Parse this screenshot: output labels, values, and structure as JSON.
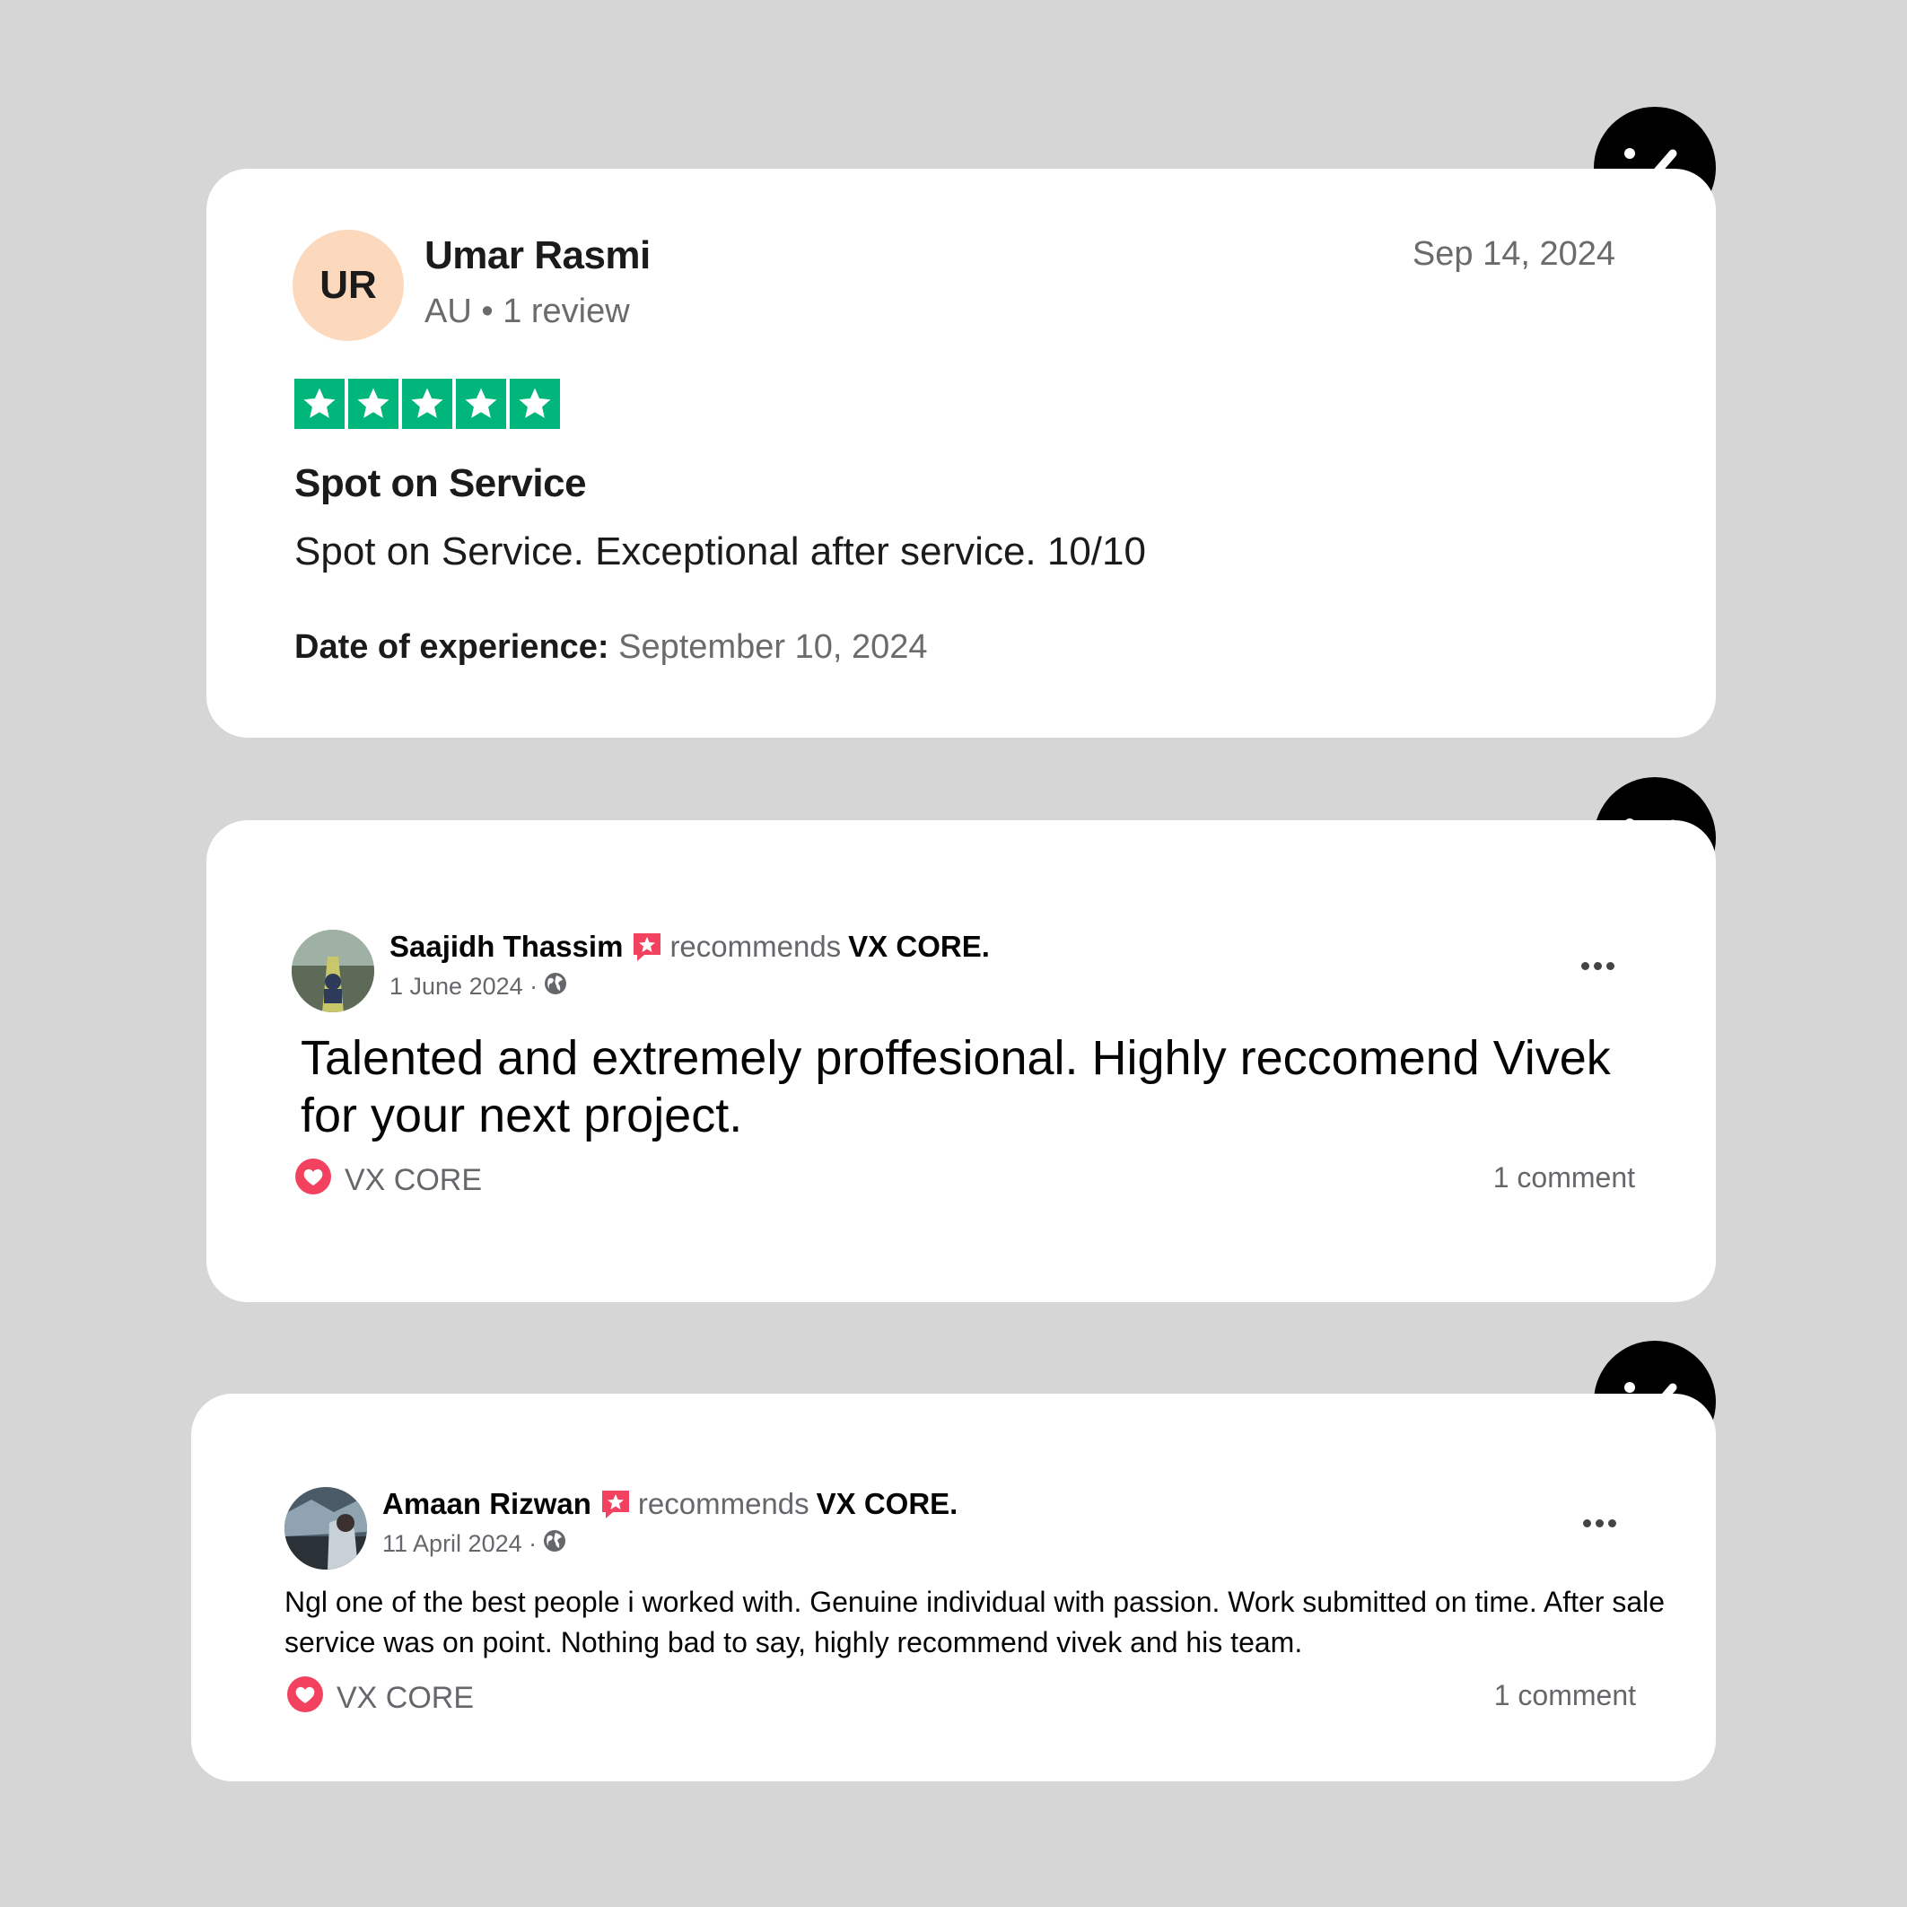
{
  "reviews": [
    {
      "source": "trustpilot",
      "avatar_initials": "UR",
      "reviewer_name": "Umar Rasmi",
      "reviewer_meta": "AU • 1 review",
      "date": "Sep 14, 2024",
      "rating": 5,
      "title": "Spot on Service",
      "body": "Spot on Service. Exceptional after service. 10/10",
      "experience_label": "Date of experience:",
      "experience_date": "September 10, 2024",
      "star_color": "#00b67a"
    },
    {
      "source": "facebook",
      "reviewer_name": "Saajidh Thassim",
      "recommends_text": "recommends",
      "page_name": "VX CORE.",
      "date": "1 June 2024 ·",
      "body": "Talented and extremely proffesional. Highly reccomend Vivek for your next project.",
      "reaction_name": "VX CORE",
      "comment_count": "1 comment"
    },
    {
      "source": "facebook",
      "reviewer_name": "Amaan Rizwan",
      "recommends_text": "recommends",
      "page_name": "VX CORE.",
      "date": "11 April 2024 ·",
      "body": "Ngl one of the best people i worked with. Genuine individual with passion. Work submitted on time. After sale service was on point. Nothing bad to say, highly recommend vivek and his team.",
      "reaction_name": "VX CORE",
      "comment_count": "1 comment"
    }
  ],
  "icons": {
    "badge": "check-stroke-icon",
    "recommend": "recommend-star-icon",
    "globe": "globe-icon",
    "heart": "heart-reaction-icon",
    "more": "more-options-icon"
  },
  "colors": {
    "background": "#d6d6d6",
    "trustpilot_green": "#00b67a",
    "facebook_recommend": "#f3425f"
  }
}
